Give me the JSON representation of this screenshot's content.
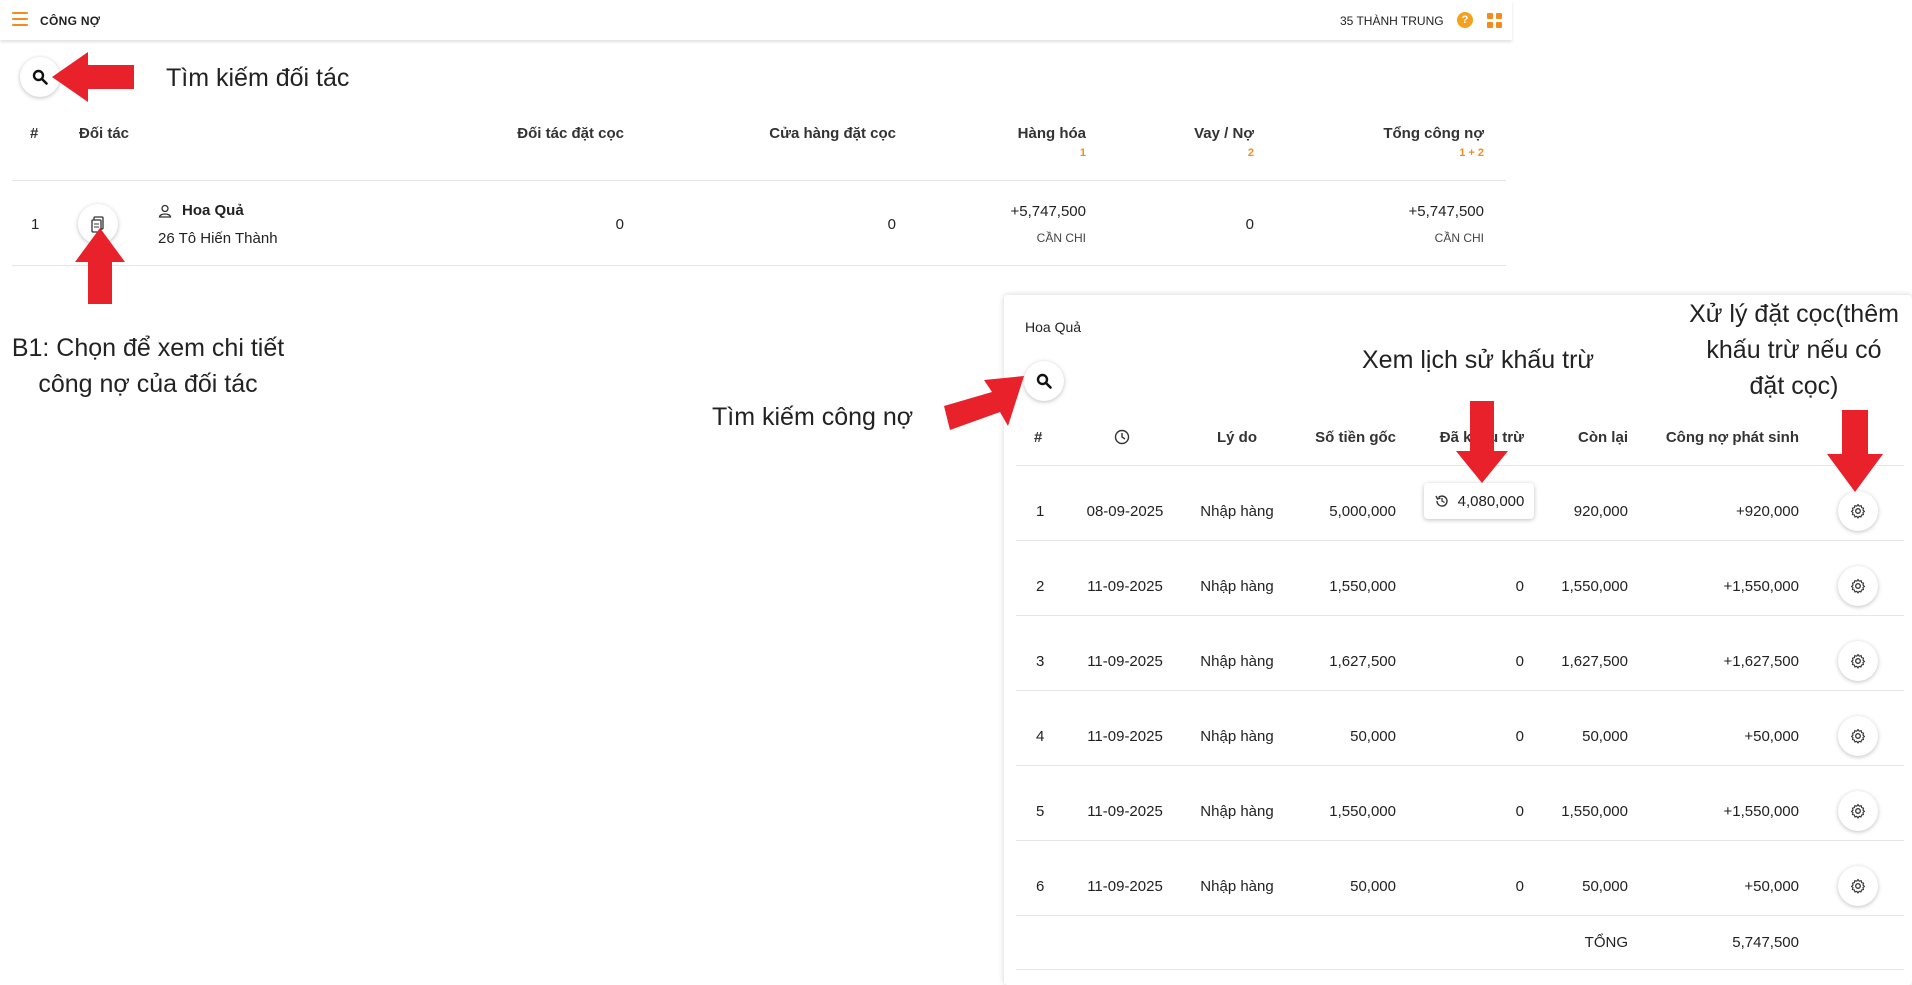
{
  "header": {
    "title": "CÔNG NỢ",
    "user": "35 THÀNH TRUNG",
    "help": "?"
  },
  "partners": {
    "columns": {
      "num": "#",
      "partner": "Đối tác",
      "partner_deposit": "Đối tác đặt cọc",
      "store_deposit": "Cửa hàng đặt cọc",
      "goods": "Hàng hóa",
      "goods_sub": "1",
      "loan": "Vay / Nợ",
      "loan_sub": "2",
      "total": "Tổng công nợ",
      "total_sub": "1 + 2"
    },
    "rows": [
      {
        "num": "1",
        "name": "Hoa Quả",
        "address": "26 Tô Hiến Thành",
        "partner_deposit": "0",
        "store_deposit": "0",
        "goods": "+5,747,500",
        "goods_status": "CẦN CHI",
        "loan": "0",
        "total": "+5,747,500",
        "total_status": "CẦN CHI"
      }
    ]
  },
  "annotations": {
    "search_partner": "Tìm kiếm đối tác",
    "step1_line1": "B1: Chọn để xem chi tiết",
    "step1_line2": "công nợ của đối tác",
    "search_debt": "Tìm kiếm công nợ",
    "view_history": "Xem lịch sử khấu trừ",
    "deposit_line1": "Xử lý đặt cọc(thêm",
    "deposit_line2": "khấu trừ nếu có",
    "deposit_line3": "đặt cọc)"
  },
  "detail": {
    "partner_name": "Hoa Quả",
    "columns": {
      "num": "#",
      "reason": "Lý do",
      "original": "Số tiền gốc",
      "deducted": "Đã khấu trừ",
      "remaining": "Còn lại",
      "arising": "Công nợ phát sinh"
    },
    "rows": [
      {
        "num": "1",
        "date": "08-09-2025",
        "reason": "Nhập hàng",
        "original": "5,000,000",
        "deducted": "4,080,000",
        "remaining": "920,000",
        "arising": "+920,000"
      },
      {
        "num": "2",
        "date": "11-09-2025",
        "reason": "Nhập hàng",
        "original": "1,550,000",
        "deducted": "0",
        "remaining": "1,550,000",
        "arising": "+1,550,000"
      },
      {
        "num": "3",
        "date": "11-09-2025",
        "reason": "Nhập hàng",
        "original": "1,627,500",
        "deducted": "0",
        "remaining": "1,627,500",
        "arising": "+1,627,500"
      },
      {
        "num": "4",
        "date": "11-09-2025",
        "reason": "Nhập hàng",
        "original": "50,000",
        "deducted": "0",
        "remaining": "50,000",
        "arising": "+50,000"
      },
      {
        "num": "5",
        "date": "11-09-2025",
        "reason": "Nhập hàng",
        "original": "1,550,000",
        "deducted": "0",
        "remaining": "1,550,000",
        "arising": "+1,550,000"
      },
      {
        "num": "6",
        "date": "11-09-2025",
        "reason": "Nhập hàng",
        "original": "50,000",
        "deducted": "0",
        "remaining": "50,000",
        "arising": "+50,000"
      }
    ],
    "total_label": "TỔNG",
    "total_value": "5,747,500"
  },
  "colors": {
    "accent": "#f28c1e",
    "arrow": "#e8212b"
  },
  "icons": [
    "menu-icon",
    "help-icon",
    "apps-grid-icon",
    "search-icon",
    "document-icon",
    "user-icon",
    "clock-icon",
    "history-icon",
    "gear-icon",
    "arrow-annotation"
  ]
}
